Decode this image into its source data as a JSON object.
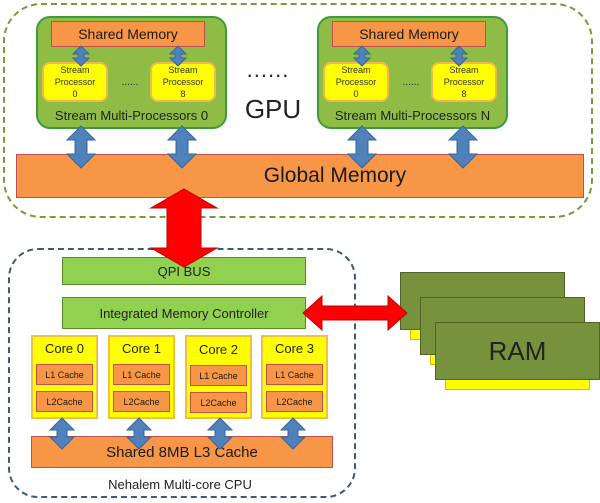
{
  "gpu": {
    "label": "GPU",
    "between_sm_ellipsis": "......",
    "multiprocessors": [
      {
        "title": "Stream Multi-Processors 0",
        "shared_memory": "Shared Memory",
        "processors": [
          {
            "line1": "Stream",
            "line2": "Processor",
            "line3": "0"
          },
          {
            "line1": "Stream",
            "line2": "Processor",
            "line3": "8"
          }
        ],
        "ellipsis": "......"
      },
      {
        "title": "Stream Multi-Processors N",
        "shared_memory": "Shared Memory",
        "processors": [
          {
            "line1": "Stream",
            "line2": "Processor",
            "line3": "0"
          },
          {
            "line1": "Stream",
            "line2": "Processor",
            "line3": "8"
          }
        ],
        "ellipsis": "......"
      }
    ],
    "global_memory": "Global Memory"
  },
  "cpu": {
    "label": "Nehalem Multi-core CPU",
    "qpi_bus": "QPI BUS",
    "memory_controller": "Integrated Memory Controller",
    "cores": [
      {
        "name": "Core 0",
        "l1": "L1 Cache",
        "l2": "L2Cache"
      },
      {
        "name": "Core 1",
        "l1": "L1 Cache",
        "l2": "L2Cache"
      },
      {
        "name": "Core 2",
        "l1": "L1 Cache",
        "l2": "L2Cache"
      },
      {
        "name": "Core 3",
        "l1": "L1 Cache",
        "l2": "L2Cache"
      }
    ],
    "l3_cache": "Shared 8MB L3 Cache"
  },
  "ram": {
    "label": "RAM"
  },
  "colors": {
    "blue_arrow": "#4f81bd",
    "red_arrow": "#ff0000",
    "orange": "#f79646",
    "green": "#92d050",
    "sm_green": "#8fbc44",
    "yellow": "#ffff00",
    "ram_green": "#76923c"
  }
}
